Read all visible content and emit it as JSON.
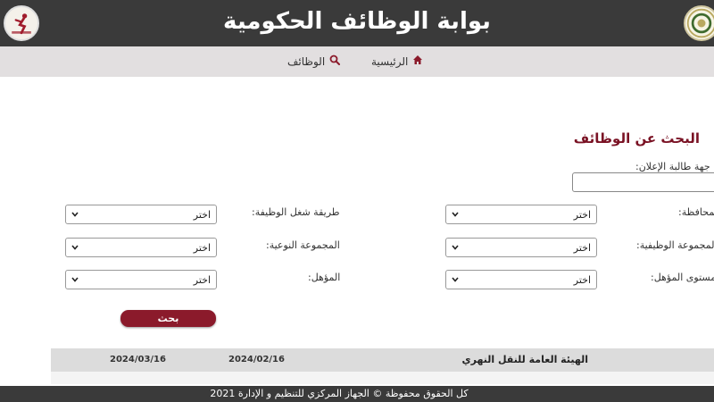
{
  "header": {
    "title": "بوابة الوظائف الحكومية"
  },
  "nav": {
    "home_label": "الرئيسية",
    "jobs_label": "الوظائف"
  },
  "search": {
    "title": "البحث عن الوظائف",
    "advertiser_label": "جهة طالبة الإعلان:",
    "governorate_label": "المحافظة:",
    "job_group_label": "المجموعة الوظيفية:",
    "qualification_level_label": "مستوى المؤهل:",
    "employment_method_label": "طريقة شغل الوظيفة:",
    "qualitative_group_label": "المجموعة النوعية:",
    "qualification_label": "المؤهل:",
    "select_default": "اختر",
    "search_button": "بحث"
  },
  "results": [
    {
      "agency": "الهيئة العامة للنقل النهري",
      "start_date": "2024/02/16",
      "end_date": "2024/03/16"
    }
  ],
  "footer": {
    "text": "كل الحقوق محفوظة © الجهاز المركزي للتنظيم و الإدارة 2021"
  },
  "colors": {
    "header_bg": "#3a3a3a",
    "nav_bg": "#e2dfe0",
    "accent": "#8b1a2b",
    "title_color": "#7a1224"
  }
}
